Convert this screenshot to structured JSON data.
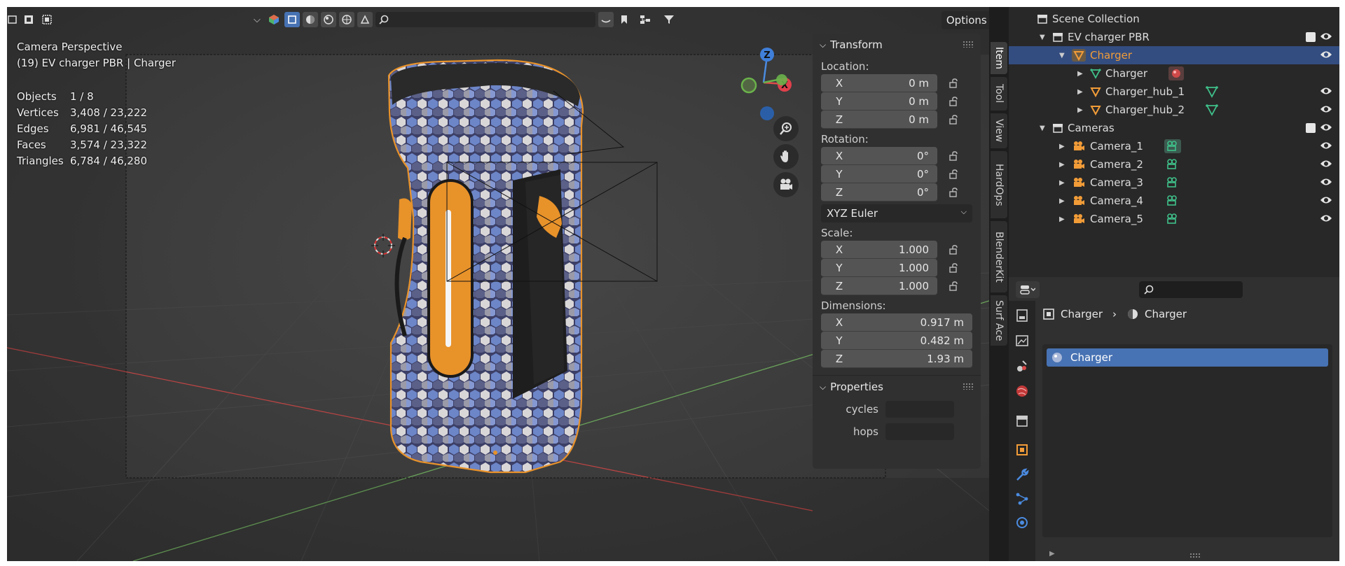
{
  "viewport": {
    "camera_label": "Camera Perspective",
    "object_label": "(19) EV charger PBR | Charger",
    "stats": [
      {
        "key": "Objects",
        "value": "1 / 8"
      },
      {
        "key": "Vertices",
        "value": "3,408 / 23,222"
      },
      {
        "key": "Edges",
        "value": "6,981 / 46,545"
      },
      {
        "key": "Faces",
        "value": "3,574 / 23,322"
      },
      {
        "key": "Triangles",
        "value": "6,784 / 46,280"
      }
    ],
    "options_label": "Options",
    "gizmo": {
      "x": "X",
      "y": "Y",
      "z": "Z"
    }
  },
  "npanel": {
    "transform_title": "Transform",
    "location_label": "Location:",
    "location": [
      {
        "axis": "X",
        "value": "0 m"
      },
      {
        "axis": "Y",
        "value": "0 m"
      },
      {
        "axis": "Z",
        "value": "0 m"
      }
    ],
    "rotation_label": "Rotation:",
    "rotation": [
      {
        "axis": "X",
        "value": "0°"
      },
      {
        "axis": "Y",
        "value": "0°"
      },
      {
        "axis": "Z",
        "value": "0°"
      }
    ],
    "rotation_mode": "XYZ Euler",
    "scale_label": "Scale:",
    "scale": [
      {
        "axis": "X",
        "value": "1.000"
      },
      {
        "axis": "Y",
        "value": "1.000"
      },
      {
        "axis": "Z",
        "value": "1.000"
      }
    ],
    "dimensions_label": "Dimensions:",
    "dimensions": [
      {
        "axis": "X",
        "value": "0.917 m"
      },
      {
        "axis": "Y",
        "value": "0.482 m"
      },
      {
        "axis": "Z",
        "value": "1.93 m"
      }
    ],
    "properties_title": "Properties",
    "props": [
      {
        "label": "cycles"
      },
      {
        "label": "hops"
      }
    ]
  },
  "tabs": [
    "Item",
    "Tool",
    "View",
    "HardOps",
    "BlenderKit",
    "Surf Ace"
  ],
  "outliner": {
    "rows": [
      {
        "label": "Scene Collection"
      },
      {
        "label": "EV charger PBR"
      },
      {
        "label": "Charger"
      },
      {
        "label": "Charger"
      },
      {
        "label": "Charger_hub_1"
      },
      {
        "label": "Charger_hub_2"
      },
      {
        "label": "Cameras"
      },
      {
        "label": "Camera_1"
      },
      {
        "label": "Camera_2"
      },
      {
        "label": "Camera_3"
      },
      {
        "label": "Camera_4"
      },
      {
        "label": "Camera_5"
      }
    ]
  },
  "properties": {
    "path_object": "Charger",
    "path_material": "Charger",
    "material_slot": "Charger"
  },
  "colors": {
    "selection": "#334d80",
    "active_blue": "#4772b3",
    "orange": "#e8922a",
    "mesh_green": "#3fc08a"
  }
}
